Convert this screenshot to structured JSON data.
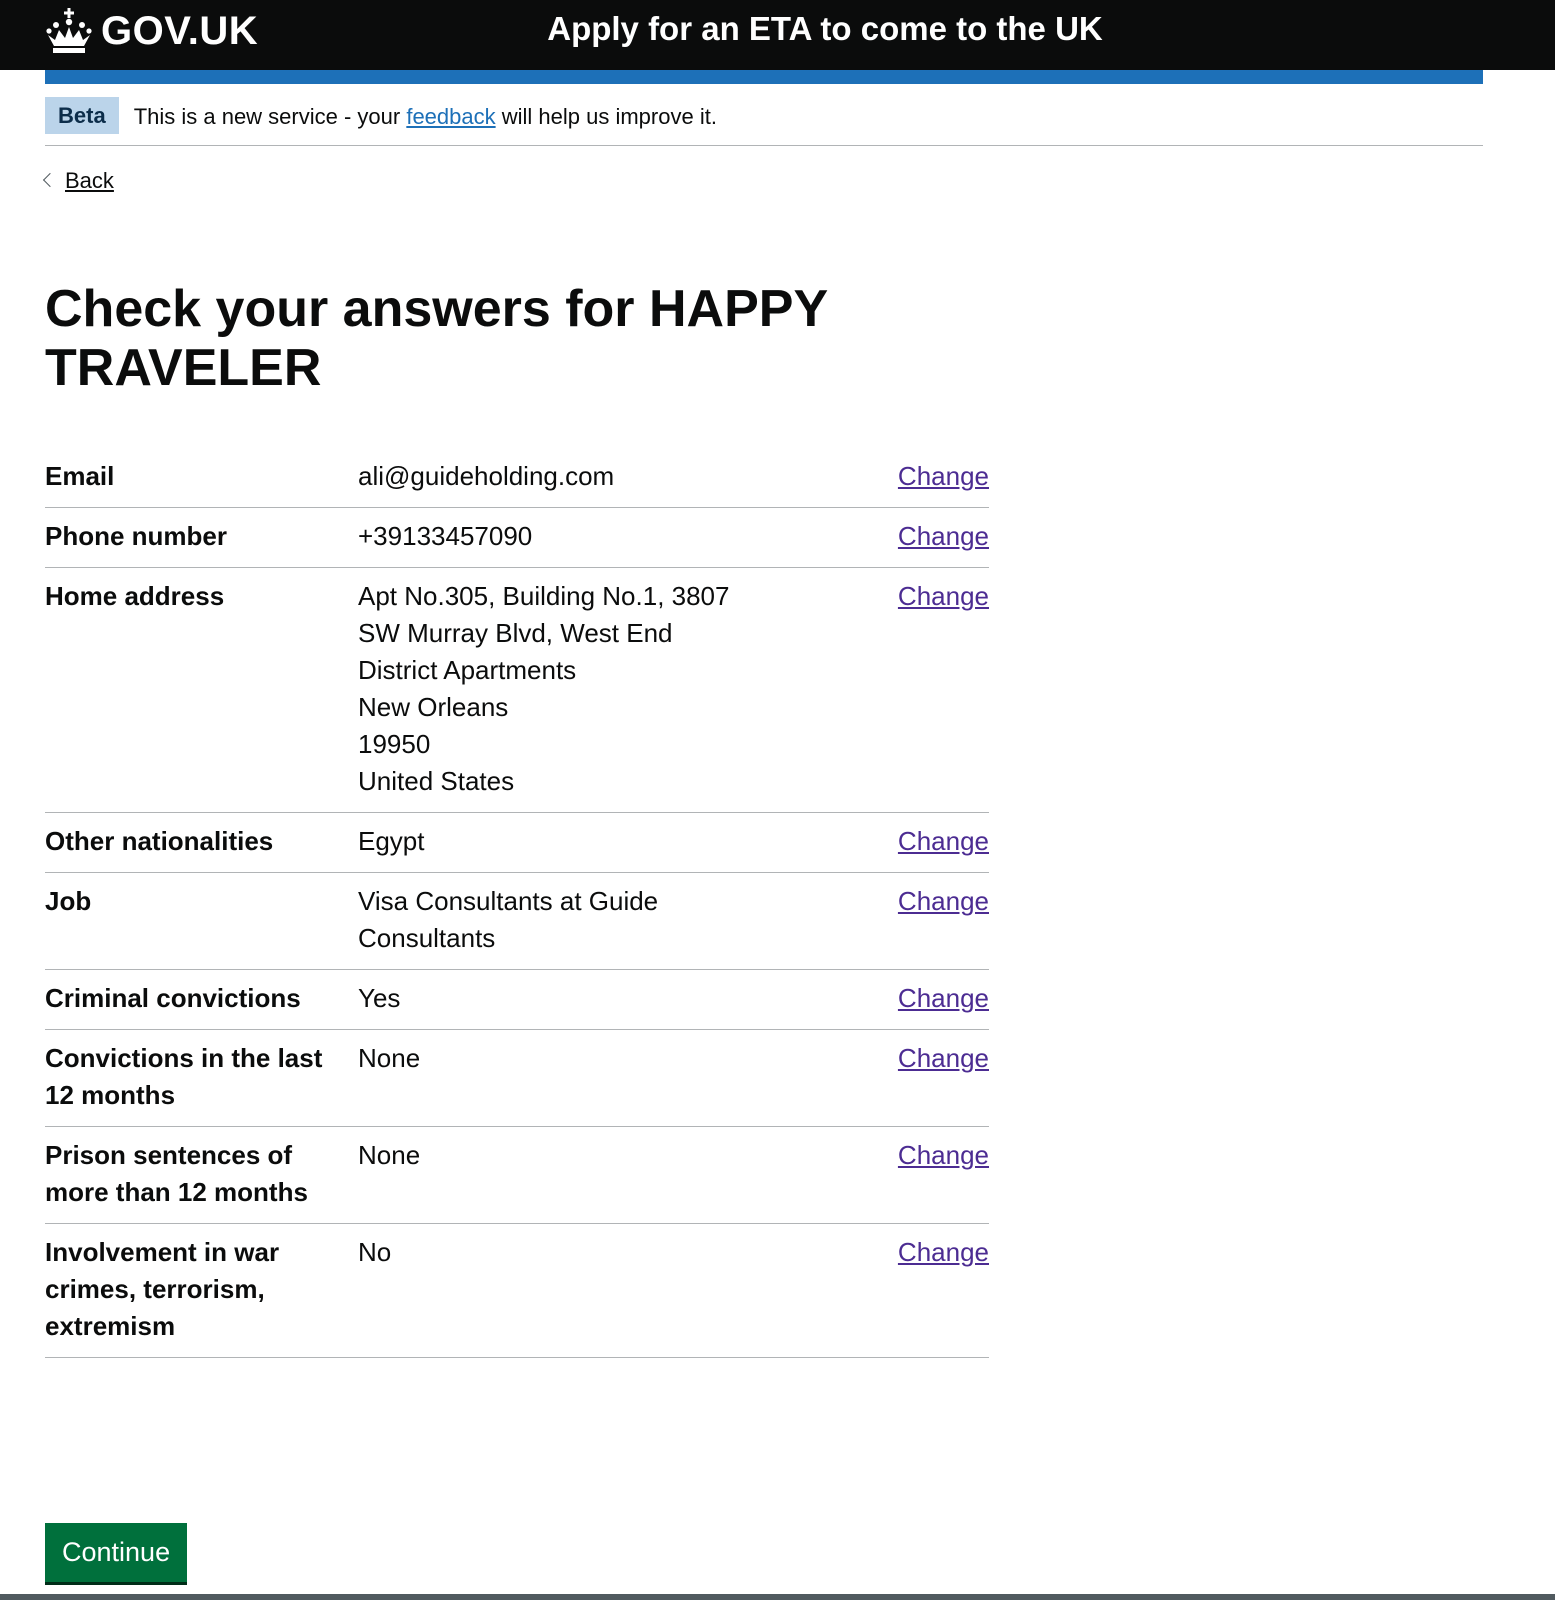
{
  "header": {
    "logo_text": "GOV.UK",
    "service_name": "Apply for an ETA to come to the UK"
  },
  "phase_banner": {
    "tag": "Beta",
    "text_before": "This is a new service - your ",
    "link": "feedback",
    "text_after": " will help us improve it."
  },
  "back_link": "Back",
  "title_line1": "Check your answers for HAPPY",
  "title_line2": "TRAVELER",
  "summary": {
    "rows": [
      {
        "key": "Email",
        "value": [
          "ali@guideholding.com"
        ],
        "action": "Change"
      },
      {
        "key": "Phone number",
        "value": [
          "+39133457090"
        ],
        "action": "Change"
      },
      {
        "key": "Home address",
        "value": [
          "Apt No.305, Building No.1, 3807",
          "SW Murray Blvd, West End",
          "District Apartments",
          "New Orleans",
          "19950",
          "United States"
        ],
        "action": "Change"
      },
      {
        "key": "Other nationalities",
        "value": [
          "Egypt"
        ],
        "action": "Change"
      },
      {
        "key": "Job",
        "value": [
          "Visa Consultants at Guide",
          "Consultants"
        ],
        "action": "Change"
      },
      {
        "key": "Criminal convictions",
        "value": [
          "Yes"
        ],
        "action": "Change"
      },
      {
        "key": "Convictions in the last 12 months",
        "value": [
          "None"
        ],
        "action": "Change"
      },
      {
        "key": "Prison sentences of more than 12 months",
        "value": [
          "None"
        ],
        "action": "Change"
      },
      {
        "key": "Involvement in war crimes, terrorism, extremism",
        "value": [
          "No"
        ],
        "action": "Change"
      }
    ]
  },
  "continue_label": "Continue",
  "colors": {
    "header_bg": "#0b0c0c",
    "brand_blue": "#1d70b8",
    "beta_tag_bg": "#bbd4ea",
    "visited_link": "#4c2c92",
    "button_green": "#00703c"
  }
}
